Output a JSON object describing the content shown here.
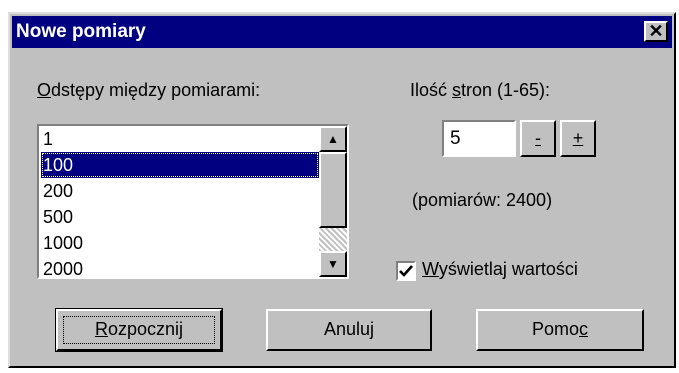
{
  "window": {
    "title": "Nowe pomiary"
  },
  "intervals": {
    "label_accel": "O",
    "label_rest": "dstępy między pomiarami:",
    "items": [
      "1",
      "100",
      "200",
      "500",
      "1000",
      "2000"
    ],
    "selected": "100"
  },
  "pages": {
    "label_pre": "Ilość ",
    "label_accel": "s",
    "label_post": "tron (1-65):",
    "value": "5",
    "dec_label": "-",
    "inc_label": "+",
    "count_text": "(pomiarów: 2400)"
  },
  "show_values": {
    "checked": true,
    "label_accel": "W",
    "label_rest": "yświetlaj wartości"
  },
  "buttons": {
    "start_accel": "R",
    "start_rest": "ozpocznij",
    "cancel": "Anuluj",
    "help_pre": "Pomo",
    "help_accel": "c"
  },
  "icons": {
    "close": "close-icon",
    "scroll_up": "arrow-up-icon",
    "scroll_down": "arrow-down-icon",
    "check": "checkmark-icon"
  }
}
